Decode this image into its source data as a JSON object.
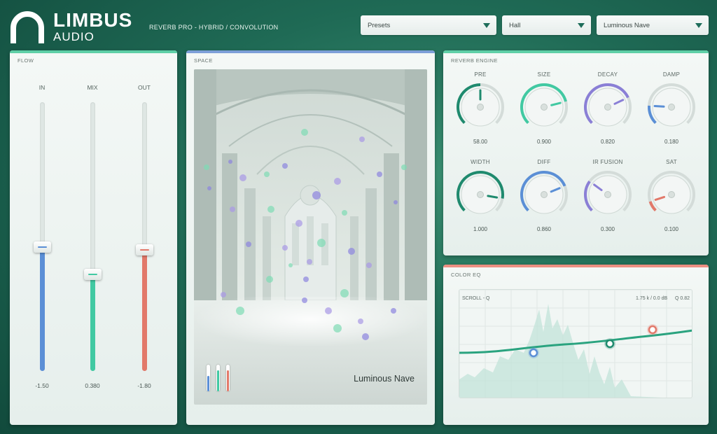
{
  "brand": {
    "name": "LIMBUS",
    "sub": "AUDIO",
    "tagline": "REVERB PRO  -  HYBRID / CONVOLUTION"
  },
  "dropdowns": {
    "presets": {
      "value": "Presets"
    },
    "category": {
      "value": "Hall"
    },
    "preset_name": {
      "value": "Luminous Nave"
    }
  },
  "flow": {
    "title": "FLOW",
    "faders": [
      {
        "label": "IN",
        "value": "-1.50",
        "level": 0.46,
        "color": "#5b8fd6"
      },
      {
        "label": "MIX",
        "value": "0.380",
        "level": 0.36,
        "color": "#41c9a2"
      },
      {
        "label": "OUT",
        "value": "-1.80",
        "level": 0.45,
        "color": "#e2796a"
      }
    ]
  },
  "space": {
    "title": "SPACE",
    "caption": "Luminous Nave",
    "meters": [
      "#5b8fd6",
      "#41c9a2",
      "#e2796a"
    ]
  },
  "engine": {
    "title": "REVERB ENGINE",
    "knobs": [
      {
        "label": "PRE",
        "value": "58.00",
        "level": 0.5,
        "color": "#1f8a6e"
      },
      {
        "label": "SIZE",
        "value": "0.900",
        "level": 0.78,
        "color": "#41c9a2"
      },
      {
        "label": "DECAY",
        "value": "0.820",
        "level": 0.74,
        "color": "#8a7fd6"
      },
      {
        "label": "DAMP",
        "value": "0.180",
        "level": 0.18,
        "color": "#5b8fd6"
      },
      {
        "label": "WIDTH",
        "value": "1.000",
        "level": 0.87,
        "color": "#1f8a6e"
      },
      {
        "label": "DIFF",
        "value": "0.860",
        "level": 0.75,
        "color": "#5b8fd6"
      },
      {
        "label": "IR FUSION",
        "value": "0.300",
        "level": 0.3,
        "color": "#8a7fd6"
      },
      {
        "label": "SAT",
        "value": "0.100",
        "level": 0.1,
        "color": "#e2796a"
      }
    ]
  },
  "eq": {
    "title": "COLOR EQ",
    "scroll_hint": "SCROLL - Q",
    "readout": "1.75 k / 0.0 dB",
    "q_readout": "Q 0.82",
    "colors": {
      "line": "#2aa37f",
      "band1": "#5b8fd6",
      "band2": "#1f8a6e",
      "band3": "#e2796a"
    }
  },
  "colors": {
    "flow_strip": "#5fcfa7",
    "space_strip": "#7d9fd8",
    "engine_strip": "#5fcfa7",
    "eq_strip": "#ec8f82"
  }
}
